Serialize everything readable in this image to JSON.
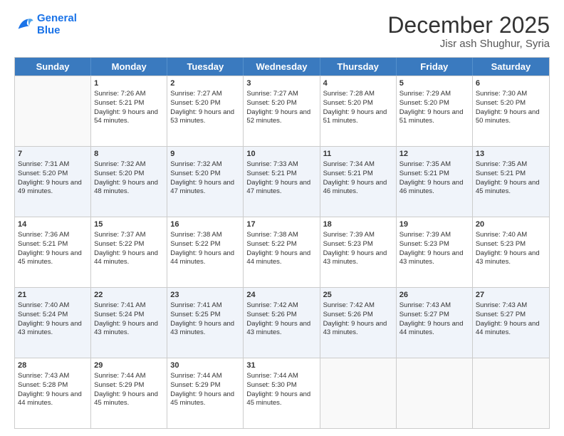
{
  "logo": {
    "line1": "General",
    "line2": "Blue"
  },
  "title": "December 2025",
  "location": "Jisr ash Shughur, Syria",
  "weekdays": [
    "Sunday",
    "Monday",
    "Tuesday",
    "Wednesday",
    "Thursday",
    "Friday",
    "Saturday"
  ],
  "weeks": [
    [
      {
        "day": "",
        "sunrise": "",
        "sunset": "",
        "daylight": "",
        "empty": true
      },
      {
        "day": "1",
        "sunrise": "Sunrise: 7:26 AM",
        "sunset": "Sunset: 5:21 PM",
        "daylight": "Daylight: 9 hours and 54 minutes."
      },
      {
        "day": "2",
        "sunrise": "Sunrise: 7:27 AM",
        "sunset": "Sunset: 5:20 PM",
        "daylight": "Daylight: 9 hours and 53 minutes."
      },
      {
        "day": "3",
        "sunrise": "Sunrise: 7:27 AM",
        "sunset": "Sunset: 5:20 PM",
        "daylight": "Daylight: 9 hours and 52 minutes."
      },
      {
        "day": "4",
        "sunrise": "Sunrise: 7:28 AM",
        "sunset": "Sunset: 5:20 PM",
        "daylight": "Daylight: 9 hours and 51 minutes."
      },
      {
        "day": "5",
        "sunrise": "Sunrise: 7:29 AM",
        "sunset": "Sunset: 5:20 PM",
        "daylight": "Daylight: 9 hours and 51 minutes."
      },
      {
        "day": "6",
        "sunrise": "Sunrise: 7:30 AM",
        "sunset": "Sunset: 5:20 PM",
        "daylight": "Daylight: 9 hours and 50 minutes."
      }
    ],
    [
      {
        "day": "7",
        "sunrise": "Sunrise: 7:31 AM",
        "sunset": "Sunset: 5:20 PM",
        "daylight": "Daylight: 9 hours and 49 minutes."
      },
      {
        "day": "8",
        "sunrise": "Sunrise: 7:32 AM",
        "sunset": "Sunset: 5:20 PM",
        "daylight": "Daylight: 9 hours and 48 minutes."
      },
      {
        "day": "9",
        "sunrise": "Sunrise: 7:32 AM",
        "sunset": "Sunset: 5:20 PM",
        "daylight": "Daylight: 9 hours and 47 minutes."
      },
      {
        "day": "10",
        "sunrise": "Sunrise: 7:33 AM",
        "sunset": "Sunset: 5:21 PM",
        "daylight": "Daylight: 9 hours and 47 minutes."
      },
      {
        "day": "11",
        "sunrise": "Sunrise: 7:34 AM",
        "sunset": "Sunset: 5:21 PM",
        "daylight": "Daylight: 9 hours and 46 minutes."
      },
      {
        "day": "12",
        "sunrise": "Sunrise: 7:35 AM",
        "sunset": "Sunset: 5:21 PM",
        "daylight": "Daylight: 9 hours and 46 minutes."
      },
      {
        "day": "13",
        "sunrise": "Sunrise: 7:35 AM",
        "sunset": "Sunset: 5:21 PM",
        "daylight": "Daylight: 9 hours and 45 minutes."
      }
    ],
    [
      {
        "day": "14",
        "sunrise": "Sunrise: 7:36 AM",
        "sunset": "Sunset: 5:21 PM",
        "daylight": "Daylight: 9 hours and 45 minutes."
      },
      {
        "day": "15",
        "sunrise": "Sunrise: 7:37 AM",
        "sunset": "Sunset: 5:22 PM",
        "daylight": "Daylight: 9 hours and 44 minutes."
      },
      {
        "day": "16",
        "sunrise": "Sunrise: 7:38 AM",
        "sunset": "Sunset: 5:22 PM",
        "daylight": "Daylight: 9 hours and 44 minutes."
      },
      {
        "day": "17",
        "sunrise": "Sunrise: 7:38 AM",
        "sunset": "Sunset: 5:22 PM",
        "daylight": "Daylight: 9 hours and 44 minutes."
      },
      {
        "day": "18",
        "sunrise": "Sunrise: 7:39 AM",
        "sunset": "Sunset: 5:23 PM",
        "daylight": "Daylight: 9 hours and 43 minutes."
      },
      {
        "day": "19",
        "sunrise": "Sunrise: 7:39 AM",
        "sunset": "Sunset: 5:23 PM",
        "daylight": "Daylight: 9 hours and 43 minutes."
      },
      {
        "day": "20",
        "sunrise": "Sunrise: 7:40 AM",
        "sunset": "Sunset: 5:23 PM",
        "daylight": "Daylight: 9 hours and 43 minutes."
      }
    ],
    [
      {
        "day": "21",
        "sunrise": "Sunrise: 7:40 AM",
        "sunset": "Sunset: 5:24 PM",
        "daylight": "Daylight: 9 hours and 43 minutes."
      },
      {
        "day": "22",
        "sunrise": "Sunrise: 7:41 AM",
        "sunset": "Sunset: 5:24 PM",
        "daylight": "Daylight: 9 hours and 43 minutes."
      },
      {
        "day": "23",
        "sunrise": "Sunrise: 7:41 AM",
        "sunset": "Sunset: 5:25 PM",
        "daylight": "Daylight: 9 hours and 43 minutes."
      },
      {
        "day": "24",
        "sunrise": "Sunrise: 7:42 AM",
        "sunset": "Sunset: 5:26 PM",
        "daylight": "Daylight: 9 hours and 43 minutes."
      },
      {
        "day": "25",
        "sunrise": "Sunrise: 7:42 AM",
        "sunset": "Sunset: 5:26 PM",
        "daylight": "Daylight: 9 hours and 43 minutes."
      },
      {
        "day": "26",
        "sunrise": "Sunrise: 7:43 AM",
        "sunset": "Sunset: 5:27 PM",
        "daylight": "Daylight: 9 hours and 44 minutes."
      },
      {
        "day": "27",
        "sunrise": "Sunrise: 7:43 AM",
        "sunset": "Sunset: 5:27 PM",
        "daylight": "Daylight: 9 hours and 44 minutes."
      }
    ],
    [
      {
        "day": "28",
        "sunrise": "Sunrise: 7:43 AM",
        "sunset": "Sunset: 5:28 PM",
        "daylight": "Daylight: 9 hours and 44 minutes."
      },
      {
        "day": "29",
        "sunrise": "Sunrise: 7:44 AM",
        "sunset": "Sunset: 5:29 PM",
        "daylight": "Daylight: 9 hours and 45 minutes."
      },
      {
        "day": "30",
        "sunrise": "Sunrise: 7:44 AM",
        "sunset": "Sunset: 5:29 PM",
        "daylight": "Daylight: 9 hours and 45 minutes."
      },
      {
        "day": "31",
        "sunrise": "Sunrise: 7:44 AM",
        "sunset": "Sunset: 5:30 PM",
        "daylight": "Daylight: 9 hours and 45 minutes."
      },
      {
        "day": "",
        "sunrise": "",
        "sunset": "",
        "daylight": "",
        "empty": true
      },
      {
        "day": "",
        "sunrise": "",
        "sunset": "",
        "daylight": "",
        "empty": true
      },
      {
        "day": "",
        "sunrise": "",
        "sunset": "",
        "daylight": "",
        "empty": true
      }
    ]
  ]
}
